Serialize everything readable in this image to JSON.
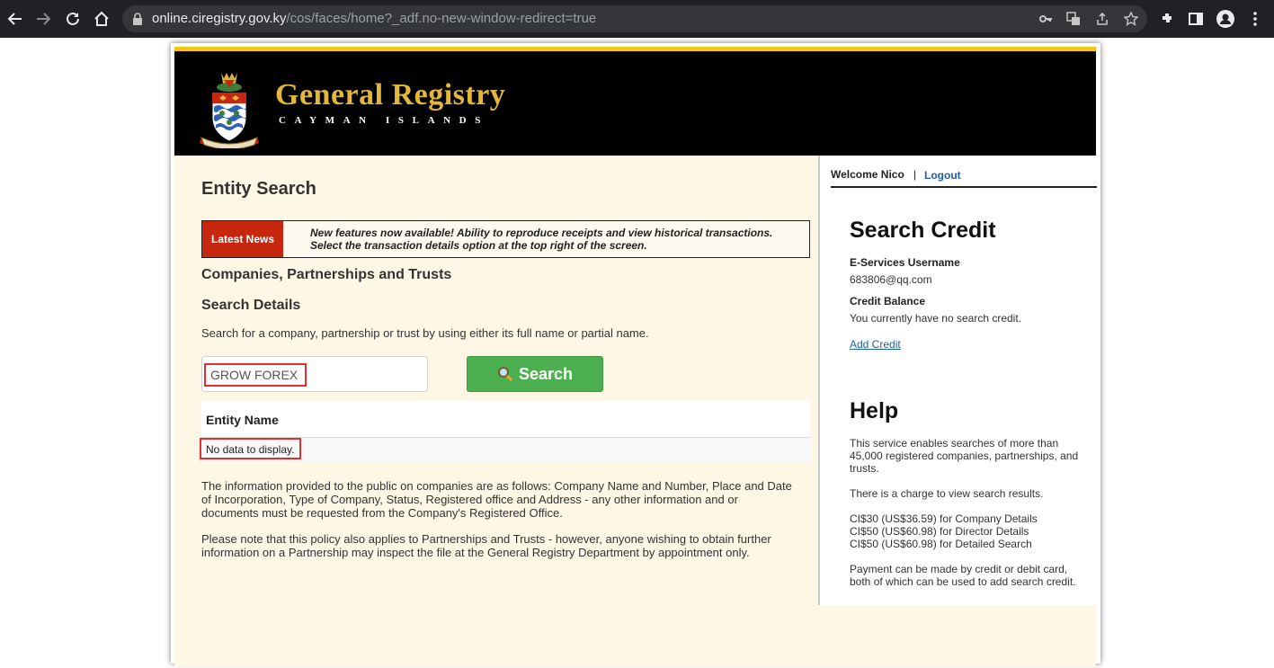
{
  "browser": {
    "url_host": "online.ciregistry.gov.ky",
    "url_path": "/cos/faces/home?_adf.no-new-window-redirect=true"
  },
  "header": {
    "title": "General Registry",
    "subtitle": "CAYMAN ISLANDS"
  },
  "main": {
    "page_title": "Entity Search",
    "news_label": "Latest News",
    "news_line1": "New features now available! Ability to reproduce receipts and view historical transactions.",
    "news_line2": "Select the transaction details option at the top right of the screen.",
    "section_title": "Companies, Partnerships and Trusts",
    "search_details_title": "Search Details",
    "intro_text": "Search for a company, partnership or trust by using either its full name or partial name.",
    "search_value": "GROW FOREX",
    "search_button": "Search",
    "grid_header": "Entity Name",
    "no_data": "No data to display.",
    "para1_line1": "The information provided to the public on companies are as follows: Company Name and Number, Place and Date",
    "para1_line2": "of Incorporation, Type of Company, Status, Registered office and Address - any other information and or",
    "para1_line3": "documents must be requested from the Company's Registered Office.",
    "para2_line1": "Please note that this policy also applies to Partnerships and Trusts - however, anyone wishing to obtain further",
    "para2_line2": "information on a Partnership may inspect the file at the General Registry Department by appointment only."
  },
  "sidebar": {
    "welcome": "Welcome Nico",
    "separator": "|",
    "logout": "Logout",
    "credit_title": "Search Credit",
    "username_label": "E-Services Username",
    "username_value": "683806@qq.com",
    "balance_label": "Credit Balance",
    "balance_value": "You currently have no search credit.",
    "add_credit": "Add Credit",
    "help_title": "Help",
    "help_1_line1": "This service enables searches of more than",
    "help_1_line2": "45,000 registered companies, partnerships, and",
    "help_1_line3": "trusts.",
    "help_2": "There is a charge to view search results.",
    "price_1": "CI$30 (US$36.59) for Company Details",
    "price_2": "CI$50 (US$60.98) for Director Details",
    "price_3": "CI$50 (US$60.98) for Detailed Search",
    "help_3_line1": "Payment can be made by credit or debit card,",
    "help_3_line2": "both of which can be used to add search credit."
  },
  "colors": {
    "brand_gold": "#e2b73a",
    "gold_bar": "#f2c713",
    "news_red": "#c7270f",
    "search_green": "#4caf50",
    "link_blue": "#1f5ea0",
    "page_bg": "#fef7e6"
  }
}
